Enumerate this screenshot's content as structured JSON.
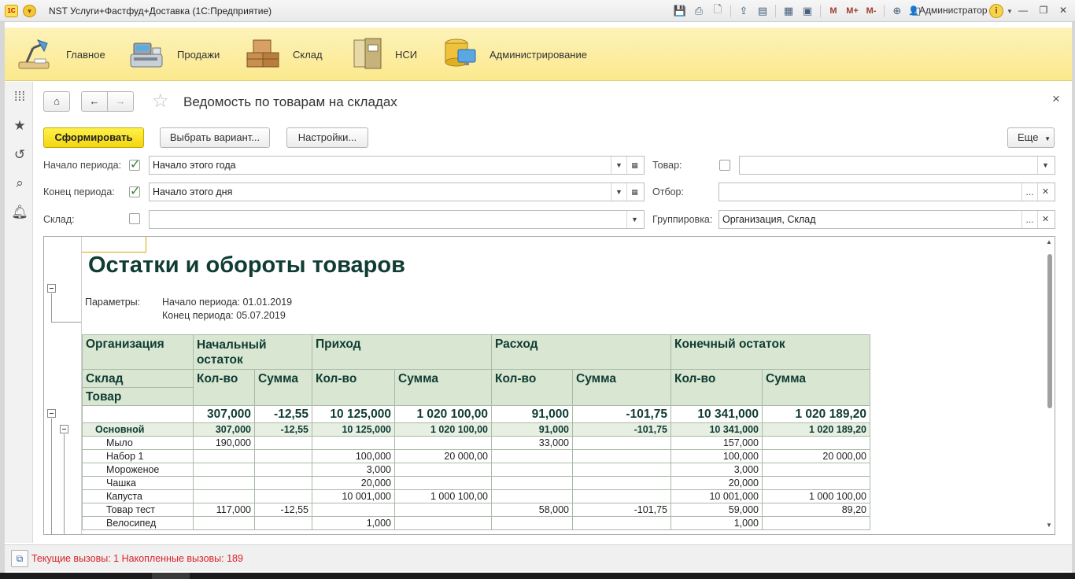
{
  "app": {
    "title": "NST Услуги+Фастфуд+Доставка  (1С:Предприятие)",
    "logo_text": "1С",
    "user": "Администратор",
    "toolbar_memory": [
      "M",
      "M+",
      "M-"
    ]
  },
  "sections": [
    {
      "label": "Главное",
      "icon": "desk-lamp-icon"
    },
    {
      "label": "Продажи",
      "icon": "cash-register-icon"
    },
    {
      "label": "Склад",
      "icon": "boxes-icon"
    },
    {
      "label": "НСИ",
      "icon": "binder-icon"
    },
    {
      "label": "Администрирование",
      "icon": "server-admin-icon"
    }
  ],
  "form": {
    "title": "Ведомость по товарам на складах",
    "buttons": {
      "generate": "Сформировать",
      "choose_variant": "Выбрать вариант...",
      "settings": "Настройки...",
      "more": "Еще"
    },
    "filters": {
      "period_start": {
        "label": "Начало периода:",
        "checked": true,
        "value": "Начало этого года"
      },
      "period_end": {
        "label": "Конец периода:",
        "checked": true,
        "value": "Начало этого дня"
      },
      "warehouse": {
        "label": "Склад:",
        "checked": false,
        "value": ""
      },
      "product": {
        "label": "Товар:",
        "checked": false,
        "value": ""
      },
      "selection": {
        "label": "Отбор:",
        "value": ""
      },
      "grouping": {
        "label": "Группировка:",
        "value": "Организация, Склад"
      }
    }
  },
  "report": {
    "title": "Остатки и обороты товаров",
    "params_label": "Параметры:",
    "params": [
      "Начало периода: 01.01.2019",
      "Конец периода: 05.07.2019"
    ],
    "header": {
      "col_org": "Организация",
      "col_wh": "Склад",
      "col_item": "Товар",
      "groups": [
        "Начальный остаток",
        "Приход",
        "Расход",
        "Конечный остаток"
      ],
      "qty": "Кол-во",
      "sum": "Сумма"
    },
    "total": {
      "label": "",
      "values": [
        "307,000",
        "-12,55",
        "10 125,000",
        "1 020 100,00",
        "91,000",
        "-101,75",
        "10 341,000",
        "1 020 189,20"
      ]
    },
    "group": {
      "label": "Основной",
      "values": [
        "307,000",
        "-12,55",
        "10 125,000",
        "1 020 100,00",
        "91,000",
        "-101,75",
        "10 341,000",
        "1 020 189,20"
      ]
    },
    "rows": [
      {
        "name": "Мыло",
        "values": [
          "190,000",
          "",
          "",
          "",
          "33,000",
          "",
          "157,000",
          ""
        ]
      },
      {
        "name": "Набор 1",
        "values": [
          "",
          "",
          "100,000",
          "20 000,00",
          "",
          "",
          "100,000",
          "20 000,00"
        ]
      },
      {
        "name": "Мороженое",
        "values": [
          "",
          "",
          "3,000",
          "",
          "",
          "",
          "3,000",
          ""
        ]
      },
      {
        "name": "Чашка",
        "values": [
          "",
          "",
          "20,000",
          "",
          "",
          "",
          "20,000",
          ""
        ]
      },
      {
        "name": "Капуста",
        "values": [
          "",
          "",
          "10 001,000",
          "1 000 100,00",
          "",
          "",
          "10 001,000",
          "1 000 100,00"
        ]
      },
      {
        "name": "Товар тест",
        "values": [
          "117,000",
          "-12,55",
          "",
          "",
          "58,000",
          "-101,75",
          "59,000",
          "89,20"
        ]
      },
      {
        "name": "Велосипед",
        "values": [
          "",
          "",
          "1,000",
          "",
          "",
          "",
          "1,000",
          ""
        ]
      }
    ]
  },
  "status": {
    "text": "Текущие вызовы: 1   Накопленные вызовы: 189"
  }
}
